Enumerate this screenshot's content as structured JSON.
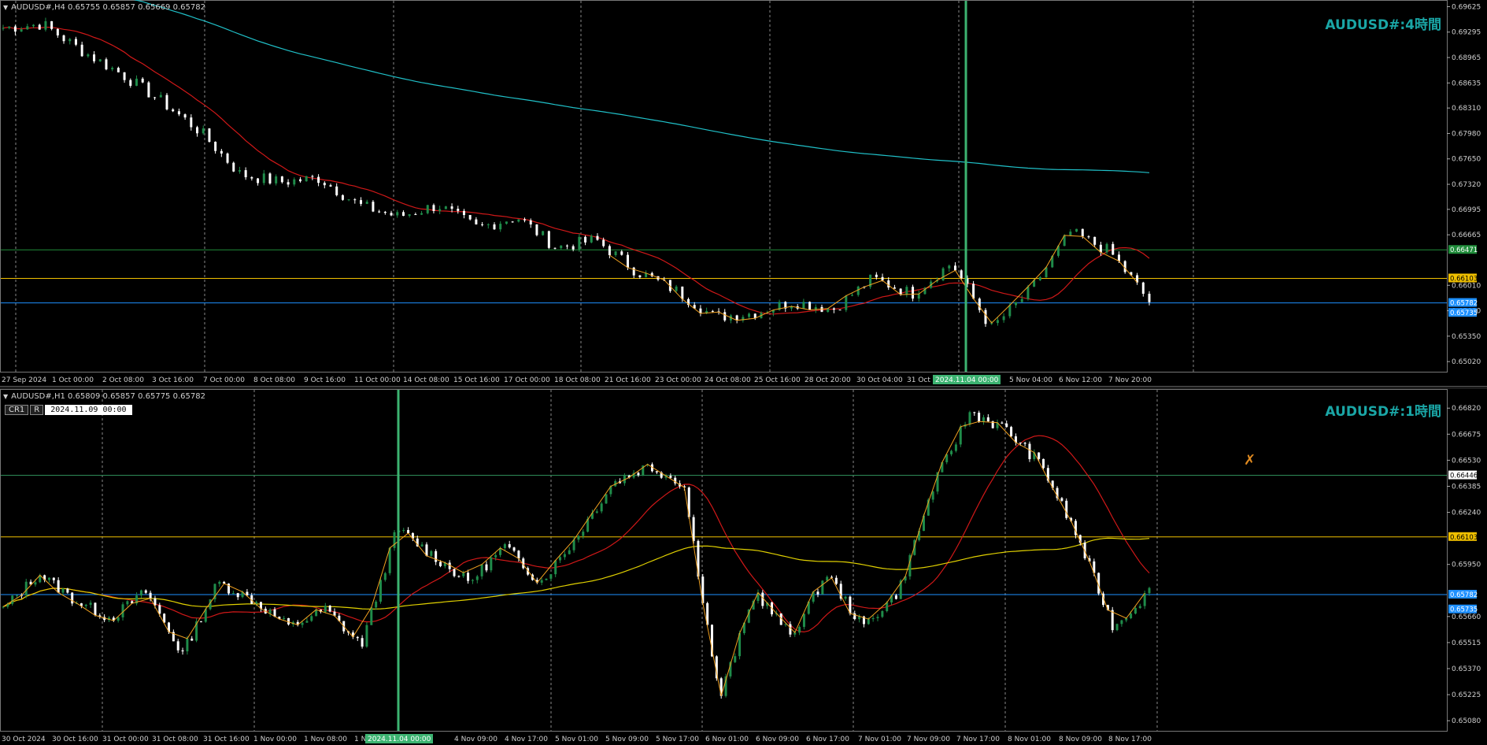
{
  "top": {
    "header": "AUDUSD#,H4  0.65755 0.65857 0.65669 0.65782",
    "title": "AUDUSD#:4時間",
    "prices": [
      "0.69625",
      "0.69295",
      "0.68965",
      "0.68635",
      "0.68310",
      "0.67980",
      "0.67650",
      "0.67320",
      "0.66995",
      "0.66665",
      "0.66010",
      "0.65680",
      "0.65350",
      "0.65020"
    ],
    "price_tags": [
      {
        "label": "0.66471",
        "y": 0.6647,
        "color": "#1f8c3a"
      },
      {
        "label": "0.66103",
        "y": 0.661,
        "color": "#f0c000"
      },
      {
        "label": "0.65782",
        "y": 0.65782,
        "color": "#1e90ff"
      },
      {
        "label": "0.65735",
        "y": 0.65735,
        "color": "#1e90ff"
      }
    ],
    "time_labels": [
      "27 Sep 2024",
      "1 Oct 00:00",
      "2 Oct 08:00",
      "3 Oct 16:00",
      "7 Oct 00:00",
      "8 Oct 08:00",
      "9 Oct 16:00",
      "11 Oct 00:00",
      "14 Oct 08:00",
      "15 Oct 16:00",
      "17 Oct 00:00",
      "18 Oct 08:00",
      "21 Oct 16:00",
      "23 Oct 00:00",
      "24 Oct 08:00",
      "25 Oct 16:00",
      "28 Oct 20:00",
      "30 Oct 04:00",
      "31 Oct",
      "5 Nov 04:00",
      "6 Nov 12:00",
      "7 Nov 20:00"
    ],
    "cursor_time": "2024.11.04 00:00"
  },
  "bottom": {
    "header": "AUDUSD#,H1  0.65809 0.65857 0.65775 0.65782",
    "title": "AUDUSD#:1時間",
    "cr_label": "CR1",
    "r_label": "R",
    "date_input": "2024.11.09 00:00",
    "prices": [
      "0.66820",
      "0.66675",
      "0.66530",
      "0.66385",
      "0.66240",
      "0.65950",
      "0.65660",
      "0.65515",
      "0.65370",
      "0.65225",
      "0.65080"
    ],
    "price_tags": [
      {
        "label": "0.66446",
        "y": 0.66446,
        "color": "#ffffff"
      },
      {
        "label": "0.66103",
        "y": 0.66103,
        "color": "#f0c000"
      },
      {
        "label": "0.65782",
        "y": 0.65782,
        "color": "#1e90ff"
      },
      {
        "label": "0.65735",
        "y": 0.65735,
        "color": "#1e90ff"
      }
    ],
    "time_labels": [
      "30 Oct 2024",
      "30 Oct 16:00",
      "31 Oct 00:00",
      "31 Oct 08:00",
      "31 Oct 16:00",
      "1 Nov 00:00",
      "1 Nov 08:00",
      "1 N",
      "1:00",
      "4 Nov 09:00",
      "4 Nov 17:00",
      "5 Nov 01:00",
      "5 Nov 09:00",
      "5 Nov 17:00",
      "6 Nov 01:00",
      "6 Nov 09:00",
      "6 Nov 17:00",
      "7 Nov 01:00",
      "7 Nov 09:00",
      "7 Nov 17:00",
      "8 Nov 01:00",
      "8 Nov 09:00",
      "8 Nov 17:00"
    ],
    "cursor_time": "2024.11.04 00:00"
  },
  "colors": {
    "up": "#1f8c4a",
    "down": "#ffffff",
    "ma_red": "#d01818",
    "ma_cyan": "#20c0c8",
    "ma_yellow": "#e0d000",
    "zigzag": "#f0a020",
    "grid": "#888888",
    "cursor": "#3cb371"
  }
}
